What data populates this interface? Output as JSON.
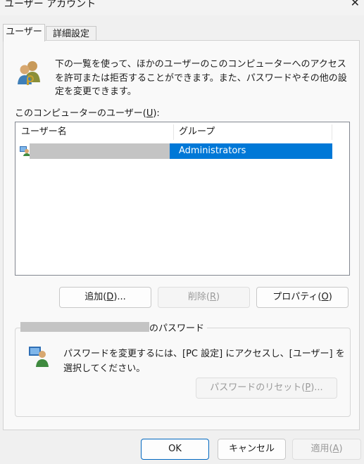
{
  "window": {
    "title": "ユーザー アカウント",
    "close_glyph": "✕"
  },
  "tabs": [
    {
      "label": "ユーザー"
    },
    {
      "label": "詳細設定"
    }
  ],
  "intro_text": "下の一覧を使って、ほかのユーザーのこのコンピューターへのアクセスを許可または拒否することができます。また、パスワードやその他の設定を変更できます。",
  "users": {
    "label_prefix": "このコンピューターのユーザー(",
    "label_key": "U",
    "label_suffix": "):",
    "columns": [
      "ユーザー名",
      "グループ"
    ],
    "rows": [
      {
        "group": "Administrators",
        "selected": true
      }
    ]
  },
  "buttons": {
    "add": {
      "label": "追加(",
      "key": "D",
      "suffix": ")..."
    },
    "remove": {
      "label": "削除(",
      "key": "R",
      "suffix": ")"
    },
    "properties": {
      "label": "プロパティ(",
      "key": "O",
      "suffix": ")"
    },
    "reset_password": {
      "label": "パスワードのリセット(",
      "key": "P",
      "suffix": ")..."
    },
    "ok": "OK",
    "cancel": "キャンセル",
    "apply": {
      "label": "適用(",
      "key": "A",
      "suffix": ")"
    }
  },
  "password_group": {
    "title_suffix": "のパスワード",
    "text": "パスワードを変更するには、[PC 設定] にアクセスし、[ユーザー] を選択してください。"
  },
  "colors": {
    "selection": "#0078d7",
    "ok_border": "#0067c0"
  }
}
